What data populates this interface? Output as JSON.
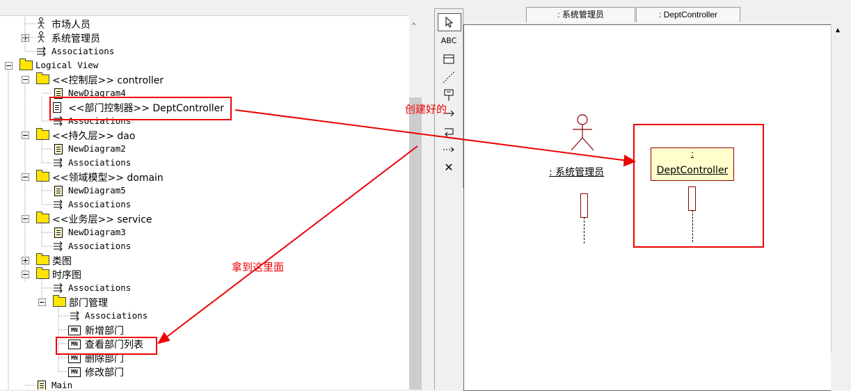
{
  "tree": {
    "rows": [
      {
        "label": "市场人员"
      },
      {
        "label": "系统管理员"
      },
      {
        "label": "Associations"
      },
      {
        "label": "Logical View"
      },
      {
        "label": "<<控制层>> controller"
      },
      {
        "label": "NewDiagram4"
      },
      {
        "label": "<<部门控制器>> DeptController"
      },
      {
        "label": "Associations"
      },
      {
        "label": "<<持久层>> dao"
      },
      {
        "label": "NewDiagram2"
      },
      {
        "label": "Associations"
      },
      {
        "label": "<<领域模型>> domain"
      },
      {
        "label": "NewDiagram5"
      },
      {
        "label": "Associations"
      },
      {
        "label": "<<业务层>> service"
      },
      {
        "label": "NewDiagram3"
      },
      {
        "label": "Associations"
      },
      {
        "label": "类图"
      },
      {
        "label": "时序图"
      },
      {
        "label": "Associations"
      },
      {
        "label": "部门管理"
      },
      {
        "label": "Associations"
      },
      {
        "label": "新增部门"
      },
      {
        "label": "查看部门列表"
      },
      {
        "label": "删除部门"
      },
      {
        "label": "修改部门"
      },
      {
        "label": "Main"
      }
    ]
  },
  "toolbox": {
    "abc_label": "ABC"
  },
  "tabs": [
    {
      "label": ": 系统管理员"
    },
    {
      "label": ": DeptController"
    }
  ],
  "diagram": {
    "actor_label": ": 系统管理员",
    "class_colon": ":",
    "class_label": "DeptController"
  },
  "annotations": {
    "created_note": "创建好的",
    "drag_note": "拿到这里面"
  },
  "colors": {
    "annotation_red": "#e00000",
    "object_fill": "#ffffcc",
    "object_border": "#8b0000",
    "folder_yellow": "#ffe500"
  }
}
